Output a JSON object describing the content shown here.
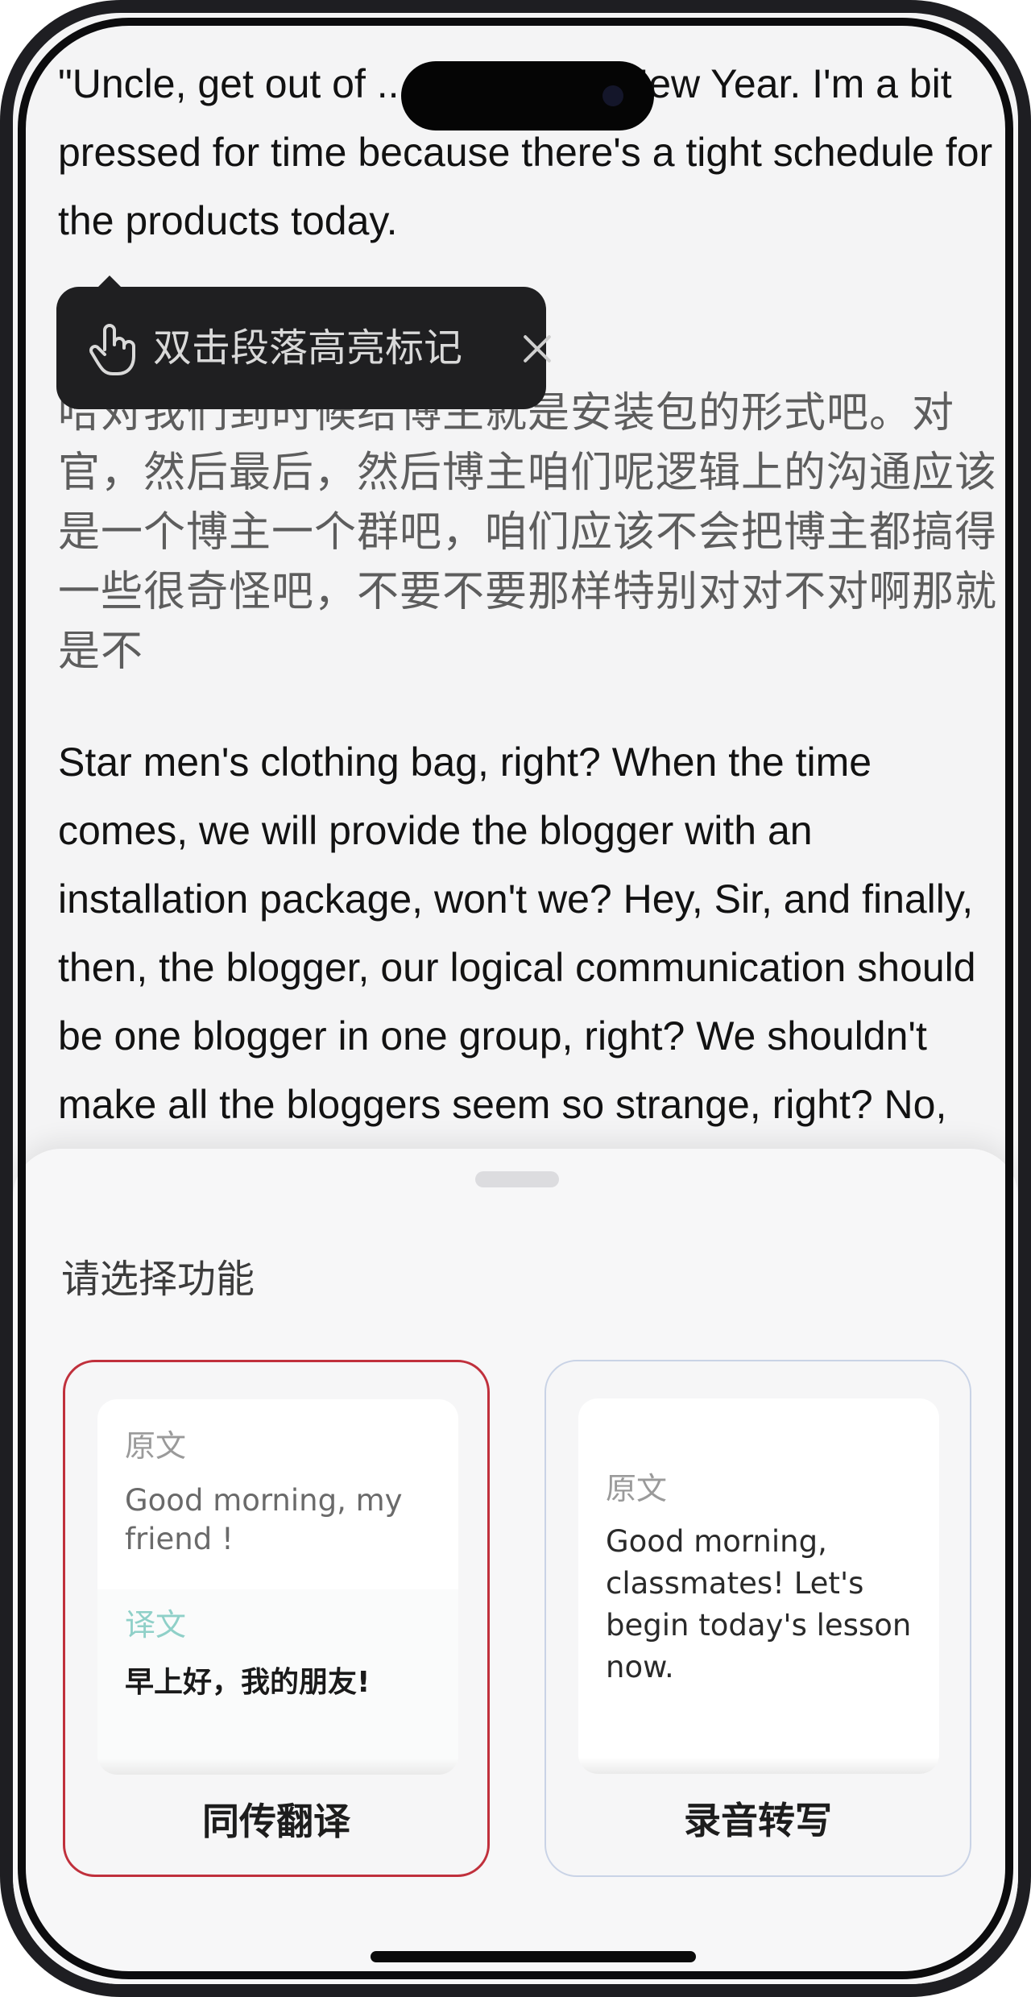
{
  "transcript": {
    "paragraph_en_1": "\"Uncle, get out of ... 's Chinese New Year. I'm a bit pressed for time because there's a tight schedule for the products today.",
    "paragraph_zh": "哈对我们到时候给博主就是安装包的形式吧。对官，然后最后，然后博主咱们呢逻辑上的沟通应该是一个博主一个群吧，咱们应该不会把博主都搞得一些很奇怪吧，不要不要那样特别对对不对啊那就是不",
    "paragraph_en_2": "Star men's clothing bag, right? When the time comes, we will provide the blogger with an installation package, won't we? Hey, Sir, and finally, then, the blogger, our logical communication should be one blogger in one group, right? We shouldn't make all the bloggers seem so strange, right? No, no, that's"
  },
  "tooltip": {
    "icon": "tap-hand-icon",
    "text": "双击段落高亮标记",
    "close_icon": "close-icon"
  },
  "sheet": {
    "title": "请选择功能",
    "cards": [
      {
        "label": "同传翻译",
        "selected": true,
        "preview_source_label": "原文",
        "preview_source_text": "Good morning, my friend !",
        "preview_translation_label": "译文",
        "preview_translation_text": "早上好，我的朋友!"
      },
      {
        "label": "录音转写",
        "selected": false,
        "preview_source_label": "原文",
        "preview_text": "Good morning, classmates! Let's begin today's lesson now."
      }
    ]
  },
  "colors": {
    "selected_border": "#c0303c",
    "unselected_border": "#c9d3e6",
    "tooltip_bg": "#1f1f21",
    "translation_label": "#8fd0c8"
  }
}
